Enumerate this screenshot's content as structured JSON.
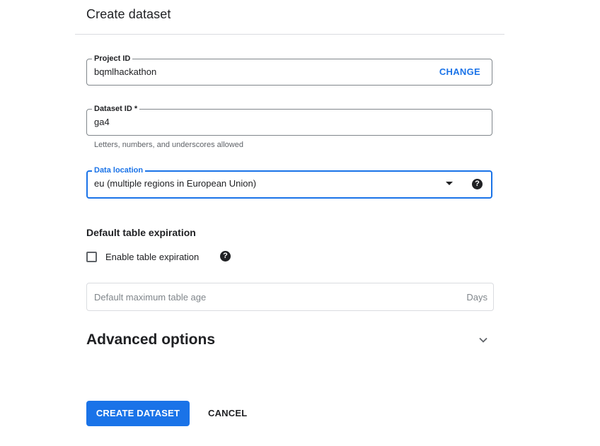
{
  "dialog": {
    "title": "Create dataset"
  },
  "project": {
    "label": "Project ID",
    "value": "bqmlhackathon",
    "change_label": "CHANGE"
  },
  "dataset": {
    "label": "Dataset ID *",
    "value": "ga4",
    "hint": "Letters, numbers, and underscores allowed"
  },
  "location": {
    "label": "Data location",
    "selected": "eu (multiple regions in European Union)",
    "help_icon": "help-icon"
  },
  "expiration": {
    "section_title": "Default table expiration",
    "checkbox_label": "Enable table expiration",
    "checked": false,
    "age_placeholder": "Default maximum table age",
    "age_suffix": "Days"
  },
  "advanced": {
    "label": "Advanced options",
    "icon": "chevron-down-icon"
  },
  "actions": {
    "create_label": "CREATE DATASET",
    "cancel_label": "CANCEL"
  },
  "colors": {
    "accent": "#1a73e8",
    "text": "#202124",
    "muted": "#5f6368",
    "border": "#80868b"
  }
}
